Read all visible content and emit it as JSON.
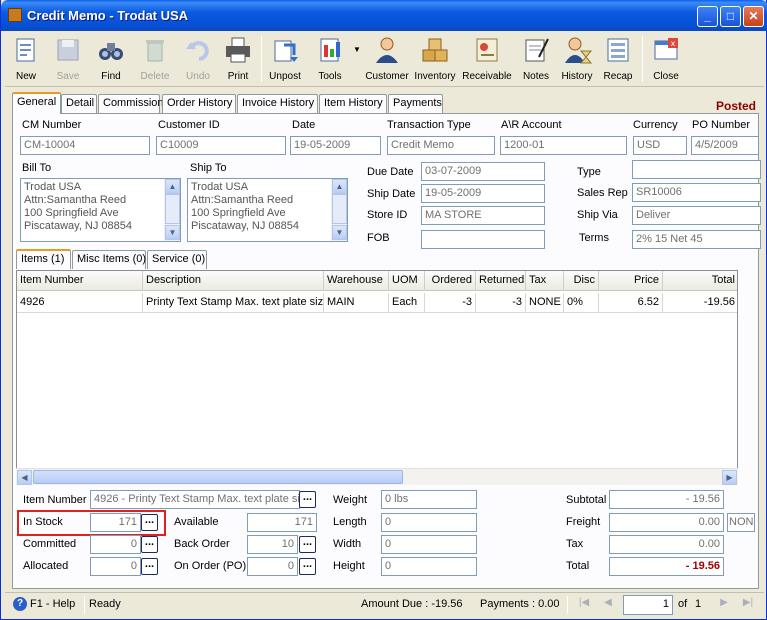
{
  "window": {
    "title": "Credit Memo - Trodat USA"
  },
  "toolbar": {
    "items": [
      {
        "label": "New",
        "icon": "new-doc-icon"
      },
      {
        "label": "Save",
        "icon": "save-icon"
      },
      {
        "label": "Find",
        "icon": "binoculars-icon"
      },
      {
        "label": "Delete",
        "icon": "trash-icon"
      },
      {
        "label": "Undo",
        "icon": "undo-icon"
      },
      {
        "label": "Print",
        "icon": "printer-icon"
      },
      {
        "label": "Unpost",
        "icon": "unpost-icon"
      },
      {
        "label": "Tools",
        "icon": "tools-icon"
      },
      {
        "label": "Customer",
        "icon": "customer-icon"
      },
      {
        "label": "Inventory",
        "icon": "boxes-icon"
      },
      {
        "label": "Receivable",
        "icon": "receivable-icon"
      },
      {
        "label": "Notes",
        "icon": "notes-icon"
      },
      {
        "label": "History",
        "icon": "history-icon"
      },
      {
        "label": "Recap",
        "icon": "recap-icon"
      },
      {
        "label": "Close",
        "icon": "close-window-icon"
      }
    ]
  },
  "tabs": [
    "General",
    "Detail",
    "Commission",
    "Order History",
    "Invoice History",
    "Item History",
    "Payments"
  ],
  "status_label": "Posted",
  "header": {
    "cm_number_label": "CM Number",
    "cm_number": "CM-10004",
    "customer_id_label": "Customer ID",
    "customer_id": "C10009",
    "date_label": "Date",
    "date": "19-05-2009",
    "transaction_type_label": "Transaction Type",
    "transaction_type": "Credit Memo",
    "ar_account_label": "A\\R Account",
    "ar_account": "1200-01",
    "currency_label": "Currency",
    "currency": "USD",
    "po_number_label": "PO Number",
    "po_number": "4/5/2009"
  },
  "bill_to": {
    "label": "Bill To",
    "lines": [
      "Trodat USA",
      "Attn:Samantha Reed",
      "100 Springfield Ave",
      "Piscataway, NJ 08854"
    ]
  },
  "ship_to": {
    "label": "Ship To",
    "lines": [
      "Trodat USA",
      "Attn:Samantha Reed",
      "100 Springfield Ave",
      "Piscataway, NJ 08854"
    ]
  },
  "dates": {
    "due_date_label": "Due Date",
    "due_date": "03-07-2009",
    "ship_date_label": "Ship Date",
    "ship_date": "19-05-2009",
    "store_id_label": "Store ID",
    "store_id": "MA STORE",
    "fob_label": "FOB",
    "fob": ""
  },
  "right_fields": {
    "type_label": "Type",
    "type": "",
    "sales_rep_label": "Sales Rep",
    "sales_rep": "SR10006",
    "ship_via_label": "Ship Via",
    "ship_via": "Deliver",
    "terms_label": "Terms",
    "terms": "2% 15 Net 45"
  },
  "subtabs": [
    "Items (1)",
    "Misc Items (0)",
    "Service (0)"
  ],
  "grid": {
    "columns": [
      "Item Number",
      "Description",
      "Warehouse",
      "UOM",
      "Ordered",
      "Returned",
      "Tax",
      "Disc",
      "Price",
      "Total"
    ],
    "rows": [
      [
        "4926",
        "Printy Text Stamp Max. text plate siz",
        "MAIN",
        "Each",
        "-3",
        "-3",
        "NONE",
        "0%",
        "6.52",
        "-19.56"
      ]
    ]
  },
  "detail": {
    "item_number_label": "Item Number",
    "item_number": "4926 - Printy Text Stamp Max. text plate siz",
    "in_stock_label": "In Stock",
    "in_stock": "171",
    "committed_label": "Committed",
    "committed": "0",
    "allocated_label": "Allocated",
    "allocated": "0",
    "available_label": "Available",
    "available": "171",
    "back_order_label": "Back Order",
    "back_order": "10",
    "on_order_label": "On Order (PO)",
    "on_order": "0",
    "weight_label": "Weight",
    "weight": "0 lbs",
    "length_label": "Length",
    "length": "0",
    "width_label": "Width",
    "width": "0",
    "height_label": "Height",
    "height": "0"
  },
  "totals": {
    "subtotal_label": "Subtotal",
    "subtotal": "- 19.56",
    "freight_label": "Freight",
    "freight": "0.00",
    "freight_code": "NON",
    "tax_label": "Tax",
    "tax": "0.00",
    "total_label": "Total",
    "total": "- 19.56"
  },
  "statusbar": {
    "help": "F1 - Help",
    "state": "Ready",
    "amount_due": "Amount Due : -19.56",
    "payments": "Payments : 0.00",
    "page": "1",
    "of_label": "of",
    "page_count": "1"
  },
  "colors": {
    "title_blue": "#0a5ae0",
    "posted_red": "#8b0000",
    "total_red": "#a10000",
    "highlight_red": "#e12020"
  }
}
